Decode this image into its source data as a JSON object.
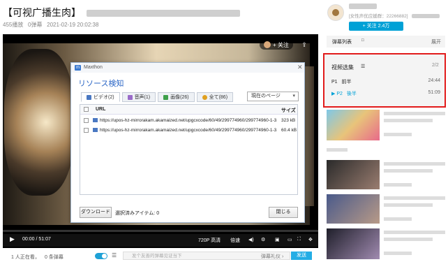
{
  "page": {
    "title": "【可视广播生肉】",
    "views": "455播放",
    "danmaku_count": "0弹幕",
    "date": "2021-02-19 20:02:38"
  },
  "player": {
    "follow_label": "+ 关注",
    "time": "00:00 / 51:07",
    "quality": "720P 高清",
    "speed": "倍速"
  },
  "dialog": {
    "app_name": "Maxthon",
    "heading": "リソース検知",
    "tabs": [
      {
        "label": "ビデオ(2)",
        "color": "#4a78c2"
      },
      {
        "label": "音声(1)",
        "color": "#9a6bc9"
      },
      {
        "label": "画像(26)",
        "color": "#3ea04a"
      },
      {
        "label": "全て(86)",
        "color": "#e0a020"
      }
    ],
    "scope": "現在のページ",
    "col_url": "URL",
    "col_size": "サイズ",
    "rows": [
      {
        "url": "https://upos-hz-mirrorakam.akamaized.net/upgcxcode/60/49/299774960/299774960-1-3...",
        "size": "323 kB"
      },
      {
        "url": "https://upos-hz-mirrorakam.akamaized.net/upgcxcode/60/49/299774960/299774960-1-3...",
        "size": "60.4 kB"
      }
    ],
    "download_label": "ダウンロード",
    "selected_label": "選択済みアイテム: 0",
    "close_label": "閉じる"
  },
  "bottom": {
    "watching": "1 人正在看，",
    "danmaku_loaded": "0 条弹幕",
    "input_placeholder": "发个友善的弹幕见证当下",
    "etiquette": "弹幕礼仪 ›",
    "send": "发送"
  },
  "sidebar": {
    "uploader_meta": "[女性声优应援群：22266882]",
    "follow": "+  关注 2.4万",
    "danmaku_list": "弹幕列表",
    "expand": "展开",
    "episodes_title": "视频选集",
    "episodes_count": "2/2",
    "episodes": [
      {
        "num": "P1",
        "name": "前半",
        "duration": "24:44"
      },
      {
        "num": "P2",
        "name": "後半",
        "duration": "51:09"
      }
    ]
  }
}
